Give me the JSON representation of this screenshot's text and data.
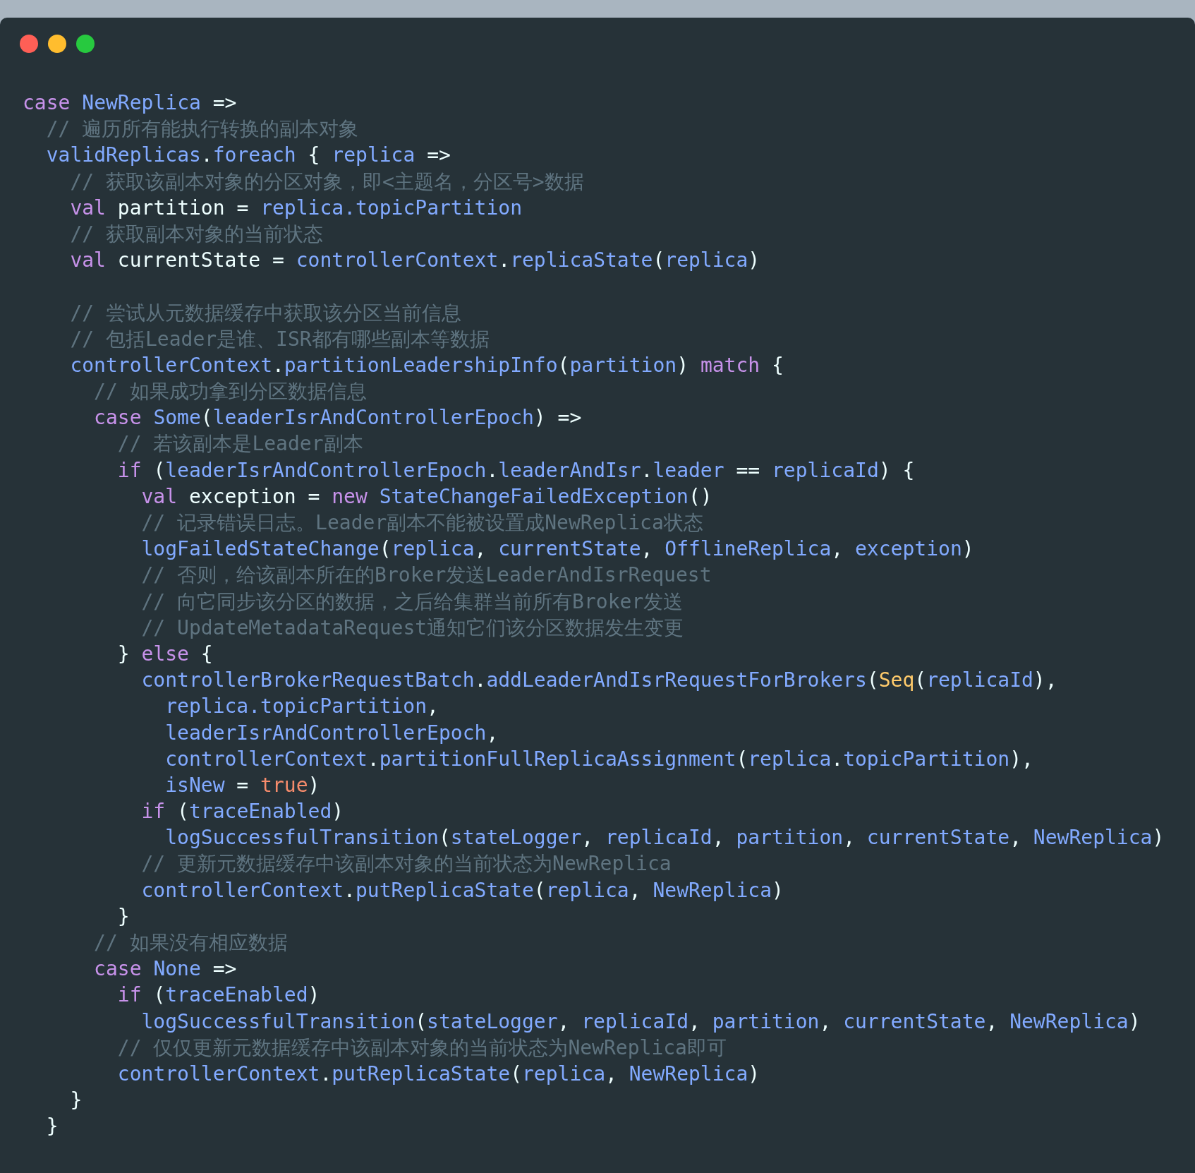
{
  "window": {
    "controls": [
      {
        "color": "#ff5f56"
      },
      {
        "color": "#ffbd2e"
      },
      {
        "color": "#27c93f"
      }
    ]
  },
  "code_lines": [
    {
      "kind": "code",
      "segments": [
        {
          "kind": "keyword",
          "text": "case "
        },
        {
          "kind": "ident",
          "text": "NewReplica"
        },
        {
          "kind": "plain",
          "text": " =>"
        }
      ],
      "children": [
        {
          "kind": "code",
          "segments": [
            {
              "kind": "comment",
              "text": "// 遍历所有能执行转换的副本对象"
            }
          ]
        },
        {
          "kind": "code",
          "segments": [
            {
              "kind": "ident",
              "text": "validReplicas"
            },
            {
              "kind": "plain",
              "text": "."
            },
            {
              "kind": "ident",
              "text": "foreach"
            },
            {
              "kind": "plain",
              "text": " { "
            },
            {
              "kind": "ident",
              "text": "replica"
            },
            {
              "kind": "plain",
              "text": " =>"
            }
          ],
          "children": [
            {
              "kind": "code",
              "segments": [
                {
                  "kind": "comment",
                  "text": "// 获取该副本对象的分区对象，即<主题名，分区号>数据"
                }
              ]
            },
            {
              "kind": "code",
              "segments": [
                {
                  "kind": "keyword",
                  "text": "val"
                },
                {
                  "kind": "plain",
                  "text": " partition = "
                },
                {
                  "kind": "ident",
                  "text": "replica."
                },
                {
                  "kind": "ident",
                  "text": "topicPartition"
                }
              ]
            },
            {
              "kind": "code",
              "segments": [
                {
                  "kind": "comment",
                  "text": "// 获取副本对象的当前状态"
                }
              ]
            },
            {
              "kind": "code",
              "segments": [
                {
                  "kind": "keyword",
                  "text": "val"
                },
                {
                  "kind": "plain",
                  "text": " currentState = "
                },
                {
                  "kind": "ident",
                  "text": "controllerContext"
                },
                {
                  "kind": "plain",
                  "text": "."
                },
                {
                  "kind": "ident",
                  "text": "replicaState"
                },
                {
                  "kind": "plain",
                  "text": "("
                },
                {
                  "kind": "ident",
                  "text": "replica"
                },
                {
                  "kind": "plain",
                  "text": ")"
                }
              ]
            },
            {
              "kind": "blank"
            },
            {
              "kind": "code",
              "segments": [
                {
                  "kind": "comment",
                  "text": "// 尝试从元数据缓存中获取该分区当前信息"
                }
              ]
            },
            {
              "kind": "code",
              "segments": [
                {
                  "kind": "comment",
                  "text": "// 包括Leader是谁、ISR都有哪些副本等数据"
                }
              ]
            },
            {
              "kind": "code",
              "segments": [
                {
                  "kind": "ident",
                  "text": "controllerContext"
                },
                {
                  "kind": "plain",
                  "text": "."
                },
                {
                  "kind": "ident",
                  "text": "partitionLeadershipInfo"
                },
                {
                  "kind": "plain",
                  "text": "("
                },
                {
                  "kind": "ident",
                  "text": "partition"
                },
                {
                  "kind": "plain",
                  "text": ") "
                },
                {
                  "kind": "keyword",
                  "text": "match"
                },
                {
                  "kind": "plain",
                  "text": " {"
                }
              ],
              "children": [
                {
                  "kind": "code",
                  "segments": [
                    {
                      "kind": "comment",
                      "text": "// 如果成功拿到分区数据信息"
                    }
                  ]
                },
                {
                  "kind": "code",
                  "segments": [
                    {
                      "kind": "keyword",
                      "text": "case "
                    },
                    {
                      "kind": "ident",
                      "text": "Some"
                    },
                    {
                      "kind": "plain",
                      "text": "("
                    },
                    {
                      "kind": "ident",
                      "text": "leaderIsrAndControllerEpoch"
                    },
                    {
                      "kind": "plain",
                      "text": ") =>"
                    }
                  ],
                  "children": [
                    {
                      "kind": "code",
                      "segments": [
                        {
                          "kind": "comment",
                          "text": "// 若该副本是Leader副本"
                        }
                      ]
                    },
                    {
                      "kind": "code",
                      "segments": [
                        {
                          "kind": "keyword",
                          "text": "if"
                        },
                        {
                          "kind": "plain",
                          "text": " ("
                        },
                        {
                          "kind": "ident",
                          "text": "leaderIsrAndControllerEpoch"
                        },
                        {
                          "kind": "plain",
                          "text": "."
                        },
                        {
                          "kind": "ident",
                          "text": "leaderAndIsr"
                        },
                        {
                          "kind": "plain",
                          "text": "."
                        },
                        {
                          "kind": "ident",
                          "text": "leader"
                        },
                        {
                          "kind": "plain",
                          "text": " == "
                        },
                        {
                          "kind": "ident",
                          "text": "replicaId"
                        },
                        {
                          "kind": "plain",
                          "text": ") {"
                        }
                      ],
                      "children": [
                        {
                          "kind": "code",
                          "segments": [
                            {
                              "kind": "keyword",
                              "text": "val"
                            },
                            {
                              "kind": "plain",
                              "text": " exception = "
                            },
                            {
                              "kind": "keyword",
                              "text": "new "
                            },
                            {
                              "kind": "ident",
                              "text": "StateChangeFailedException"
                            },
                            {
                              "kind": "plain",
                              "text": "()"
                            }
                          ]
                        },
                        {
                          "kind": "code",
                          "segments": [
                            {
                              "kind": "comment",
                              "text": "// 记录错误日志。Leader副本不能被设置成NewReplica状态"
                            }
                          ]
                        },
                        {
                          "kind": "code",
                          "segments": [
                            {
                              "kind": "ident",
                              "text": "logFailedStateChange"
                            },
                            {
                              "kind": "plain",
                              "text": "("
                            },
                            {
                              "kind": "ident",
                              "text": "replica"
                            },
                            {
                              "kind": "plain",
                              "text": ", "
                            },
                            {
                              "kind": "ident",
                              "text": "currentState"
                            },
                            {
                              "kind": "plain",
                              "text": ", "
                            },
                            {
                              "kind": "ident",
                              "text": "OfflineReplica"
                            },
                            {
                              "kind": "plain",
                              "text": ", "
                            },
                            {
                              "kind": "ident",
                              "text": "exception"
                            },
                            {
                              "kind": "plain",
                              "text": ")"
                            }
                          ]
                        },
                        {
                          "kind": "code",
                          "segments": [
                            {
                              "kind": "comment",
                              "text": "// 否则，给该副本所在的Broker发送LeaderAndIsrRequest"
                            }
                          ]
                        },
                        {
                          "kind": "code",
                          "segments": [
                            {
                              "kind": "comment",
                              "text": "// 向它同步该分区的数据，之后给集群当前所有Broker发送"
                            }
                          ]
                        },
                        {
                          "kind": "code",
                          "segments": [
                            {
                              "kind": "comment",
                              "text": "// UpdateMetadataRequest通知它们该分区数据发生变更"
                            }
                          ]
                        }
                      ]
                    },
                    {
                      "kind": "code",
                      "segments": [
                        {
                          "kind": "plain",
                          "text": "} "
                        },
                        {
                          "kind": "keyword",
                          "text": "else"
                        },
                        {
                          "kind": "plain",
                          "text": " {"
                        }
                      ],
                      "children": [
                        {
                          "kind": "code",
                          "segments": [
                            {
                              "kind": "ident",
                              "text": "controllerBrokerRequestBatch"
                            },
                            {
                              "kind": "plain",
                              "text": "."
                            },
                            {
                              "kind": "ident",
                              "text": "addLeaderAndIsrRequestForBrokers"
                            },
                            {
                              "kind": "plain",
                              "text": "("
                            },
                            {
                              "kind": "type",
                              "text": "Seq"
                            },
                            {
                              "kind": "plain",
                              "text": "("
                            },
                            {
                              "kind": "ident",
                              "text": "replicaId"
                            },
                            {
                              "kind": "plain",
                              "text": "),"
                            }
                          ],
                          "children": [
                            {
                              "kind": "code",
                              "segments": [
                                {
                                  "kind": "ident",
                                  "text": "replica."
                                },
                                {
                                  "kind": "ident",
                                  "text": "topicPartition"
                                },
                                {
                                  "kind": "plain",
                                  "text": ","
                                }
                              ]
                            },
                            {
                              "kind": "code",
                              "segments": [
                                {
                                  "kind": "ident",
                                  "text": "leaderIsrAndControllerEpoch"
                                },
                                {
                                  "kind": "plain",
                                  "text": ","
                                }
                              ]
                            },
                            {
                              "kind": "code",
                              "segments": [
                                {
                                  "kind": "ident",
                                  "text": "controllerContext"
                                },
                                {
                                  "kind": "plain",
                                  "text": "."
                                },
                                {
                                  "kind": "ident",
                                  "text": "partitionFullReplicaAssignment"
                                },
                                {
                                  "kind": "plain",
                                  "text": "("
                                },
                                {
                                  "kind": "ident",
                                  "text": "replica"
                                },
                                {
                                  "kind": "plain",
                                  "text": "."
                                },
                                {
                                  "kind": "ident",
                                  "text": "topicPartition"
                                },
                                {
                                  "kind": "plain",
                                  "text": "),"
                                }
                              ]
                            },
                            {
                              "kind": "code",
                              "segments": [
                                {
                                  "kind": "ident",
                                  "text": "isNew"
                                },
                                {
                                  "kind": "plain",
                                  "text": " = "
                                },
                                {
                                  "kind": "literal",
                                  "text": "true"
                                },
                                {
                                  "kind": "plain",
                                  "text": ")"
                                }
                              ]
                            }
                          ]
                        },
                        {
                          "kind": "code",
                          "segments": [
                            {
                              "kind": "keyword",
                              "text": "if"
                            },
                            {
                              "kind": "plain",
                              "text": " ("
                            },
                            {
                              "kind": "ident",
                              "text": "traceEnabled"
                            },
                            {
                              "kind": "plain",
                              "text": ")"
                            }
                          ],
                          "children": [
                            {
                              "kind": "code",
                              "segments": [
                                {
                                  "kind": "ident",
                                  "text": "logSuccessfulTransition"
                                },
                                {
                                  "kind": "plain",
                                  "text": "("
                                },
                                {
                                  "kind": "ident",
                                  "text": "stateLogger"
                                },
                                {
                                  "kind": "plain",
                                  "text": ", "
                                },
                                {
                                  "kind": "ident",
                                  "text": "replicaId"
                                },
                                {
                                  "kind": "plain",
                                  "text": ", "
                                },
                                {
                                  "kind": "ident",
                                  "text": "partition"
                                },
                                {
                                  "kind": "plain",
                                  "text": ", "
                                },
                                {
                                  "kind": "ident",
                                  "text": "currentState"
                                },
                                {
                                  "kind": "plain",
                                  "text": ", "
                                },
                                {
                                  "kind": "ident",
                                  "text": "NewReplica"
                                },
                                {
                                  "kind": "plain",
                                  "text": ")"
                                }
                              ]
                            }
                          ]
                        },
                        {
                          "kind": "code",
                          "segments": [
                            {
                              "kind": "comment",
                              "text": "// 更新元数据缓存中该副本对象的当前状态为NewReplica"
                            }
                          ]
                        },
                        {
                          "kind": "code",
                          "segments": [
                            {
                              "kind": "ident",
                              "text": "controllerContext"
                            },
                            {
                              "kind": "plain",
                              "text": "."
                            },
                            {
                              "kind": "ident",
                              "text": "putReplicaState"
                            },
                            {
                              "kind": "plain",
                              "text": "("
                            },
                            {
                              "kind": "ident",
                              "text": "replica"
                            },
                            {
                              "kind": "plain",
                              "text": ", "
                            },
                            {
                              "kind": "ident",
                              "text": "NewReplica"
                            },
                            {
                              "kind": "plain",
                              "text": ")"
                            }
                          ]
                        }
                      ]
                    },
                    {
                      "kind": "code",
                      "segments": [
                        {
                          "kind": "plain",
                          "text": "}"
                        }
                      ]
                    }
                  ]
                },
                {
                  "kind": "code",
                  "segments": [
                    {
                      "kind": "comment",
                      "text": "// 如果没有相应数据"
                    }
                  ]
                },
                {
                  "kind": "code",
                  "segments": [
                    {
                      "kind": "keyword",
                      "text": "case "
                    },
                    {
                      "kind": "ident",
                      "text": "None"
                    },
                    {
                      "kind": "plain",
                      "text": " =>"
                    }
                  ],
                  "children": [
                    {
                      "kind": "code",
                      "segments": [
                        {
                          "kind": "keyword",
                          "text": "if"
                        },
                        {
                          "kind": "plain",
                          "text": " ("
                        },
                        {
                          "kind": "ident",
                          "text": "traceEnabled"
                        },
                        {
                          "kind": "plain",
                          "text": ")"
                        }
                      ],
                      "children": [
                        {
                          "kind": "code",
                          "segments": [
                            {
                              "kind": "ident",
                              "text": "logSuccessfulTransition"
                            },
                            {
                              "kind": "plain",
                              "text": "("
                            },
                            {
                              "kind": "ident",
                              "text": "stateLogger"
                            },
                            {
                              "kind": "plain",
                              "text": ", "
                            },
                            {
                              "kind": "ident",
                              "text": "replicaId"
                            },
                            {
                              "kind": "plain",
                              "text": ", "
                            },
                            {
                              "kind": "ident",
                              "text": "partition"
                            },
                            {
                              "kind": "plain",
                              "text": ", "
                            },
                            {
                              "kind": "ident",
                              "text": "currentState"
                            },
                            {
                              "kind": "plain",
                              "text": ", "
                            },
                            {
                              "kind": "ident",
                              "text": "NewReplica"
                            },
                            {
                              "kind": "plain",
                              "text": ")"
                            }
                          ]
                        }
                      ]
                    },
                    {
                      "kind": "code",
                      "segments": [
                        {
                          "kind": "comment",
                          "text": "// 仅仅更新元数据缓存中该副本对象的当前状态为NewReplica即可"
                        }
                      ]
                    },
                    {
                      "kind": "code",
                      "segments": [
                        {
                          "kind": "ident",
                          "text": "controllerContext"
                        },
                        {
                          "kind": "plain",
                          "text": "."
                        },
                        {
                          "kind": "ident",
                          "text": "putReplicaState"
                        },
                        {
                          "kind": "plain",
                          "text": "("
                        },
                        {
                          "kind": "ident",
                          "text": "replica"
                        },
                        {
                          "kind": "plain",
                          "text": ", "
                        },
                        {
                          "kind": "ident",
                          "text": "NewReplica"
                        },
                        {
                          "kind": "plain",
                          "text": ")"
                        }
                      ]
                    }
                  ]
                }
              ]
            },
            {
              "kind": "code",
              "segments": [
                {
                  "kind": "plain",
                  "text": "}"
                }
              ]
            }
          ]
        },
        {
          "kind": "code",
          "segments": [
            {
              "kind": "plain",
              "text": "}"
            }
          ]
        }
      ]
    }
  ]
}
